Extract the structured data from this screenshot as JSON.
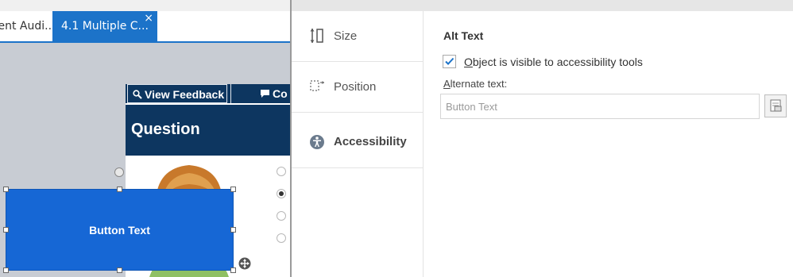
{
  "editor": {
    "tabs": [
      {
        "label": "tent Audi..."
      },
      {
        "label": "4.1 Multiple C...",
        "close_glyph": "×"
      }
    ],
    "slide": {
      "view_feedback_label": "View Feedback",
      "comment_label": "Co",
      "question_title": "Question",
      "radio_options": [
        {
          "checked": false
        },
        {
          "checked": true
        },
        {
          "checked": false
        },
        {
          "checked": false
        }
      ]
    },
    "selected_button_text": "Button Text",
    "colors": {
      "tab_active": "#1c73c9",
      "slide_header": "#0d3660",
      "button_fill": "#1667d5"
    }
  },
  "panel": {
    "nav": [
      {
        "label": "Size",
        "icon": "size-icon"
      },
      {
        "label": "Position",
        "icon": "position-icon"
      },
      {
        "label": "Accessibility",
        "icon": "accessibility-icon",
        "active": true
      }
    ],
    "alt_text": {
      "section_title": "Alt Text",
      "checkbox_checked": true,
      "checkbox_label_accesskey": "O",
      "checkbox_label_rest": "bject is visible to accessibility tools",
      "field_label_accesskey": "A",
      "field_label_rest": "lternate text:",
      "field_value": "",
      "field_placeholder": "Button Text"
    },
    "colors": {
      "check": "#1c73c9"
    }
  }
}
